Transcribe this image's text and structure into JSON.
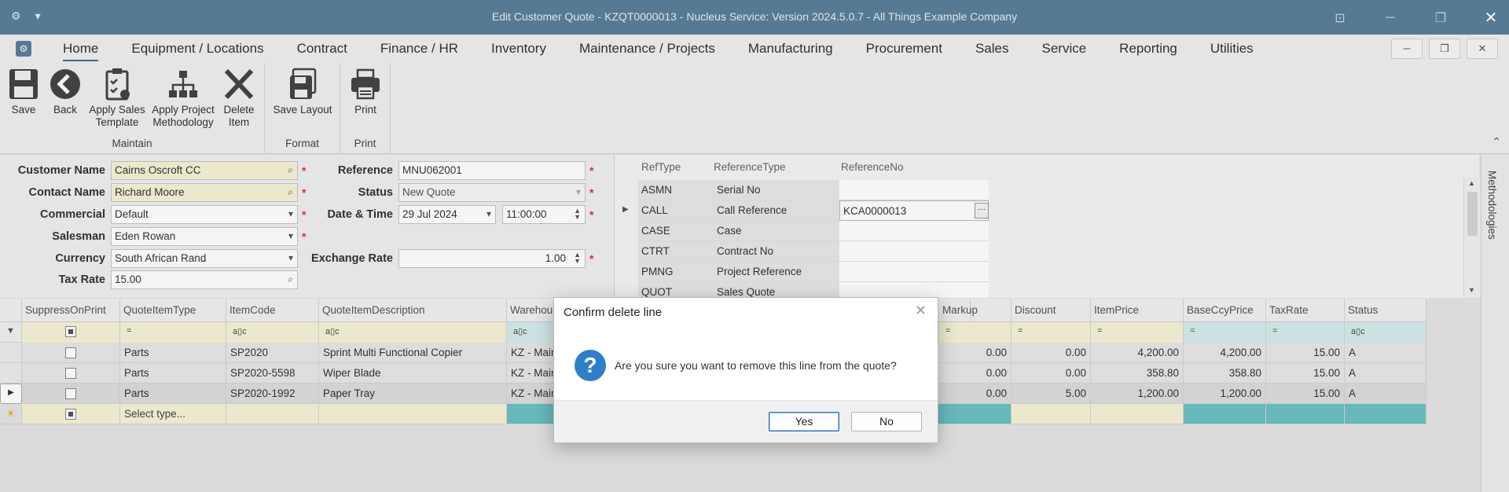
{
  "window": {
    "title": "Edit Customer Quote - KZQT0000013 - Nucleus Service: Version 2024.5.0.7 - All Things Example Company"
  },
  "menu": {
    "items": [
      "Home",
      "Equipment / Locations",
      "Contract",
      "Finance / HR",
      "Inventory",
      "Maintenance / Projects",
      "Manufacturing",
      "Procurement",
      "Sales",
      "Service",
      "Reporting",
      "Utilities"
    ],
    "active": "Home"
  },
  "ribbon": {
    "maintain_group": "Maintain",
    "format_group": "Format",
    "print_group": "Print",
    "save": "Save",
    "back": "Back",
    "apply_sales_template_1": "Apply Sales",
    "apply_sales_template_2": "Template",
    "apply_project_methodology_1": "Apply Project",
    "apply_project_methodology_2": "Methodology",
    "delete_item_1": "Delete",
    "delete_item_2": "Item",
    "save_layout": "Save Layout",
    "print": "Print"
  },
  "form": {
    "customer_name_label": "Customer Name",
    "customer_name": "Cairns Oscroft CC",
    "contact_name_label": "Contact Name",
    "contact_name": "Richard Moore",
    "commercial_label": "Commercial",
    "commercial": "Default",
    "salesman_label": "Salesman",
    "salesman": "Eden Rowan",
    "currency_label": "Currency",
    "currency": "South African Rand",
    "tax_rate_label": "Tax Rate",
    "tax_rate": "15.00",
    "reference_label": "Reference",
    "reference": "MNU062001",
    "status_label": "Status",
    "status": "New Quote",
    "datetime_label": "Date & Time",
    "date": "29 Jul 2024",
    "time": "11:00:00",
    "exchange_rate_label": "Exchange Rate",
    "exchange_rate": "1.00",
    "required_mark": "*"
  },
  "references": {
    "headers": [
      "RefType",
      "ReferenceType",
      "ReferenceNo"
    ],
    "rows": [
      {
        "reftype": "ASMN",
        "referencetype": "Serial No",
        "referenceno": ""
      },
      {
        "reftype": "CALL",
        "referencetype": "Call Reference",
        "referenceno": "KCA0000013"
      },
      {
        "reftype": "CASE",
        "referencetype": "Case",
        "referenceno": ""
      },
      {
        "reftype": "CTRT",
        "referencetype": "Contract No",
        "referenceno": ""
      },
      {
        "reftype": "PMNG",
        "referencetype": "Project Reference",
        "referenceno": ""
      },
      {
        "reftype": "QUOT",
        "referencetype": "Sales Quote",
        "referenceno": ""
      }
    ]
  },
  "side_panel": {
    "label": "Methodologies"
  },
  "items_grid": {
    "headers": [
      "SuppressOnPrint",
      "QuoteItemType",
      "ItemCode",
      "QuoteItemDescription",
      "Warehou",
      "Markup",
      "Discount",
      "ItemPrice",
      "BaseCcyPrice",
      "TaxRate",
      "Status"
    ],
    "filter_equals": "=",
    "filter_text": "a▯c",
    "rows": [
      {
        "type": "Parts",
        "code": "SP2020",
        "description": "Sprint Multi Functional Copier",
        "warehouse": "KZ - Main",
        "markup": "0.00",
        "discount": "0.00",
        "itemprice": "4,200.00",
        "baseccyprice": "4,200.00",
        "taxrate": "15.00",
        "status": "A"
      },
      {
        "type": "Parts",
        "code": "SP2020-5598",
        "description": "Wiper Blade",
        "warehouse": "KZ - Main",
        "markup": "0.00",
        "discount": "0.00",
        "itemprice": "358.80",
        "baseccyprice": "358.80",
        "taxrate": "15.00",
        "status": "A"
      },
      {
        "type": "Parts",
        "code": "SP2020-1992",
        "description": "Paper Tray",
        "warehouse": "KZ - Main",
        "markup": "0.00",
        "discount": "5.00",
        "itemprice": "1,200.00",
        "baseccyprice": "1,200.00",
        "taxrate": "15.00",
        "status": "A"
      }
    ],
    "new_row_placeholder": "Select type..."
  },
  "dialog": {
    "title": "Confirm delete line",
    "message": "Are you sure you want to remove this line from the quote?",
    "yes": "Yes",
    "no": "No"
  },
  "colors": {
    "titlebar": "#5a7f9b",
    "required": "#d33333",
    "mandatory_field": "#f5f2d6",
    "teal_cell": "#6cc0c2",
    "question_icon": "#2f7fc8"
  }
}
